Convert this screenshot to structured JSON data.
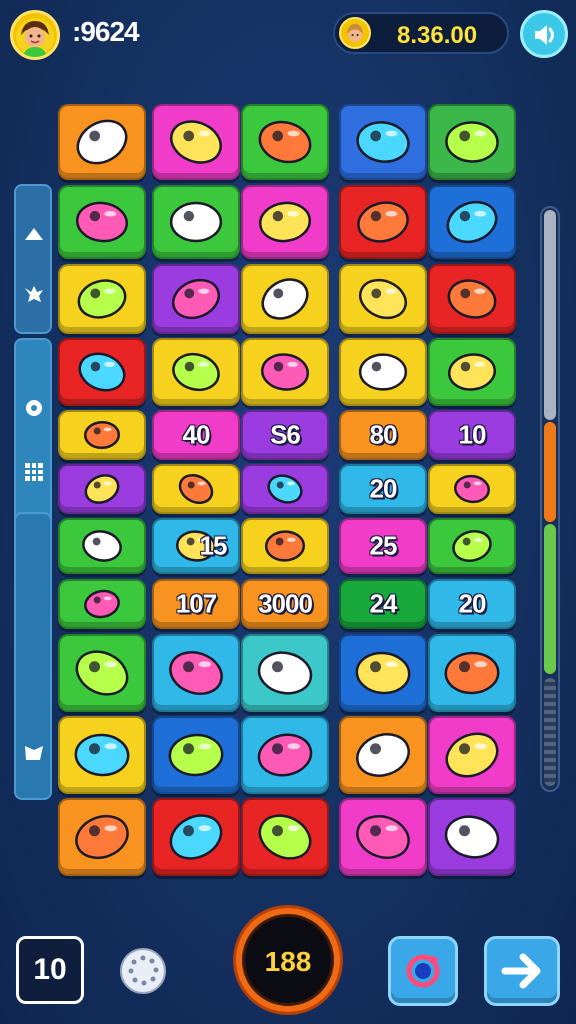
{
  "header": {
    "score": ":9624",
    "coins": "8.36.00"
  },
  "bottom": {
    "level": "10",
    "center_value": "188"
  },
  "board": {
    "rows": [
      [
        {
          "color": "#f7931e",
          "icon": "flower-toy"
        },
        {
          "color": "#f03cc8",
          "icon": "bone"
        },
        {
          "color": "#3cc83c",
          "icon": "pineapple"
        },
        {
          "color": "#2f6fe0",
          "icon": "rocket"
        },
        {
          "color": "#3cb84a",
          "icon": "torch"
        }
      ],
      [
        {
          "color": "#3cc83c",
          "icon": "palm-leaves"
        },
        {
          "color": "#3cc83c",
          "icon": "tube"
        },
        {
          "color": "#f03cc8",
          "icon": "battery"
        },
        {
          "color": "#e82424",
          "icon": "toolbox"
        },
        {
          "color": "#1f6fd8",
          "icon": "envelope"
        }
      ],
      [
        {
          "color": "#f6d21e",
          "icon": "radio"
        },
        {
          "color": "#9a3ce0",
          "icon": "box"
        },
        {
          "color": "#f6d21e",
          "icon": "mushroom"
        },
        {
          "color": "#f6d21e",
          "icon": "flashlight"
        },
        {
          "color": "#e82424",
          "icon": "car"
        }
      ],
      [
        {
          "color": "#e82424",
          "icon": "pot"
        },
        {
          "color": "#f6d21e",
          "icon": "leaf"
        },
        {
          "color": "#f6d21e",
          "icon": "backpack"
        },
        {
          "color": "#f6d21e",
          "icon": "frog"
        },
        {
          "color": "#3cc83c",
          "icon": "pipe"
        }
      ],
      [
        {
          "color": "#f6d21e",
          "icon": "sun-stars"
        },
        {
          "color": "#f03cc8",
          "number": "40"
        },
        {
          "color": "#9a3ce0",
          "number": "S6"
        },
        {
          "color": "#f7931e",
          "number": "80"
        },
        {
          "color": "#9a3ce0",
          "number": "10"
        }
      ],
      [
        {
          "color": "#9a3ce0",
          "icon": "fish-duo"
        },
        {
          "color": "#f6d21e",
          "icon": "fish"
        },
        {
          "color": "#9a3ce0",
          "icon": "ball-star"
        },
        {
          "color": "#2fb8e8",
          "number": "20"
        },
        {
          "color": "#f6d21e",
          "icon": "arrow-cone"
        }
      ],
      [
        {
          "color": "#3cc83c",
          "icon": "herb"
        },
        {
          "color": "#2fb8e8",
          "icon": "leaf-number",
          "number": "15"
        },
        {
          "color": "#f6d21e",
          "icon": "bottle-sun"
        },
        {
          "color": "#f03cc8",
          "number": "25"
        },
        {
          "color": "#3cc83c",
          "icon": "feather"
        }
      ],
      [
        {
          "color": "#3cc83c",
          "icon": "car"
        },
        {
          "color": "#f7931e",
          "number": "107"
        },
        {
          "color": "#f7931e",
          "number": "3000"
        },
        {
          "color": "#19a83c",
          "number": "24"
        },
        {
          "color": "#2fb8e8",
          "number": "20"
        }
      ],
      [
        {
          "color": "#3cc83c",
          "icon": "crab"
        },
        {
          "color": "#2fb8e8",
          "icon": "horn"
        },
        {
          "color": "#3cc8c8",
          "icon": "tools"
        },
        {
          "color": "#1f6fd8",
          "icon": "basket"
        },
        {
          "color": "#2fb8e8",
          "icon": "branch"
        }
      ],
      [
        {
          "color": "#f6d21e",
          "icon": "sun-face"
        },
        {
          "color": "#1f6fd8",
          "icon": "cup"
        },
        {
          "color": "#2fb8e8",
          "icon": "tents"
        },
        {
          "color": "#f7931e",
          "icon": "candy"
        },
        {
          "color": "#f03cc8",
          "icon": "bird"
        }
      ],
      [
        {
          "color": "#f7931e",
          "icon": "crayon"
        },
        {
          "color": "#e82424",
          "icon": "face"
        },
        {
          "color": "#e82424",
          "icon": "candy-bar"
        },
        {
          "color": "#f03cc8",
          "icon": "sunflower"
        },
        {
          "color": "#9a3ce0",
          "icon": "chick"
        }
      ]
    ]
  },
  "side_icons": [
    "up-arrow-icon",
    "bird-icon",
    "circle-icon",
    "grid-icon",
    "square-icon",
    "arrow-icon"
  ]
}
